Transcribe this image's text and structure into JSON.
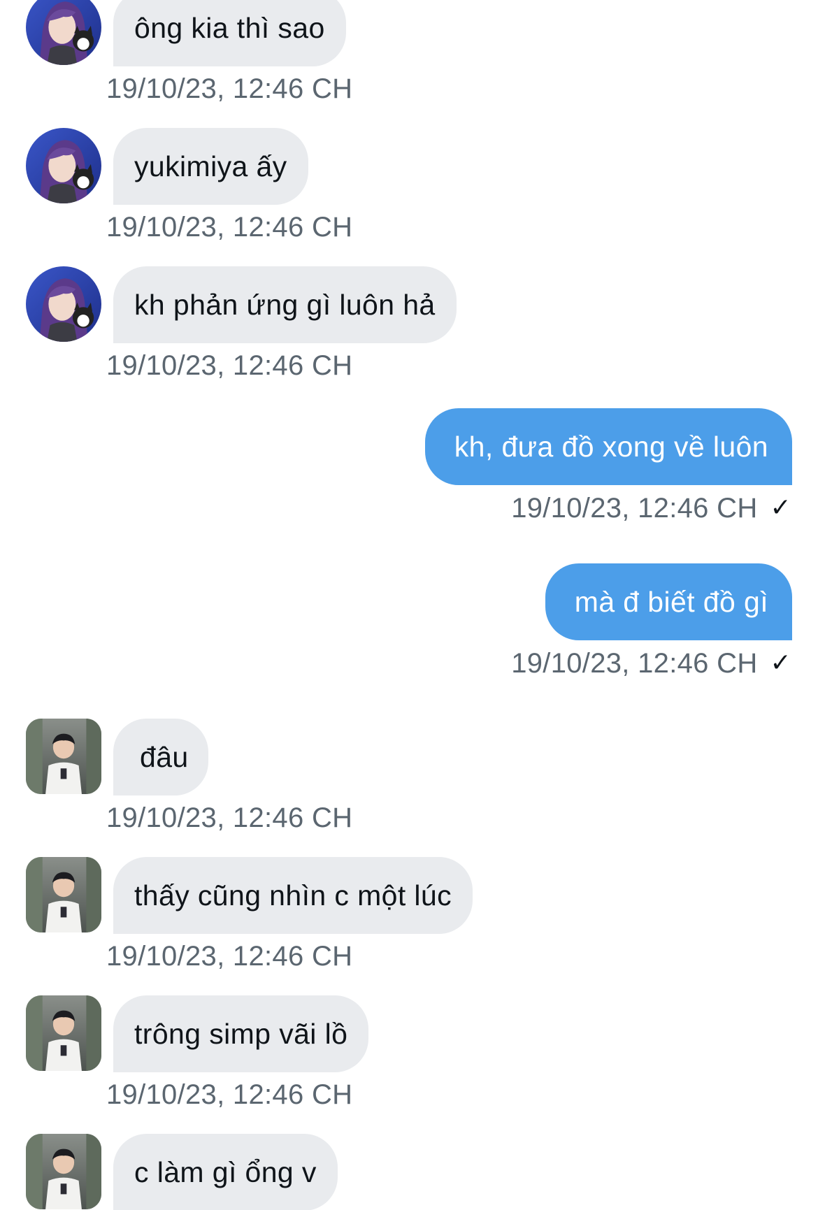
{
  "messages": [
    {
      "direction": "in",
      "avatar": "anime-avatar",
      "text": "ông kia thì sao",
      "time": "19/10/23, 12:46 CH"
    },
    {
      "direction": "in",
      "avatar": "anime-avatar",
      "text": "yukimiya ấy",
      "time": "19/10/23, 12:46 CH"
    },
    {
      "direction": "in",
      "avatar": "anime-avatar",
      "text": "kh phản ứng gì luôn hả",
      "time": "19/10/23, 12:46 CH"
    },
    {
      "direction": "out",
      "text": "kh, đưa đồ xong về luôn",
      "time": "19/10/23, 12:46 CH",
      "status_icon": "checkmark-icon"
    },
    {
      "direction": "out",
      "text": "mà đ biết đồ gì",
      "time": "19/10/23, 12:46 CH",
      "status_icon": "checkmark-icon"
    },
    {
      "direction": "in",
      "avatar": "photo-avatar",
      "text": "đâu",
      "time": "19/10/23, 12:46 CH"
    },
    {
      "direction": "in",
      "avatar": "photo-avatar",
      "text": "thấy cũng nhìn c một lúc",
      "time": "19/10/23, 12:46 CH"
    },
    {
      "direction": "in",
      "avatar": "photo-avatar",
      "text": "trông simp vãi lồ",
      "time": "19/10/23, 12:46 CH"
    },
    {
      "direction": "in",
      "avatar": "photo-avatar",
      "text": "c làm gì ổng v",
      "time": ""
    }
  ],
  "colors": {
    "incoming_bubble": "#e9ebee",
    "outgoing_bubble": "#4c9ee9",
    "timestamp_text": "#5b6670",
    "message_text": "#0f1419"
  }
}
